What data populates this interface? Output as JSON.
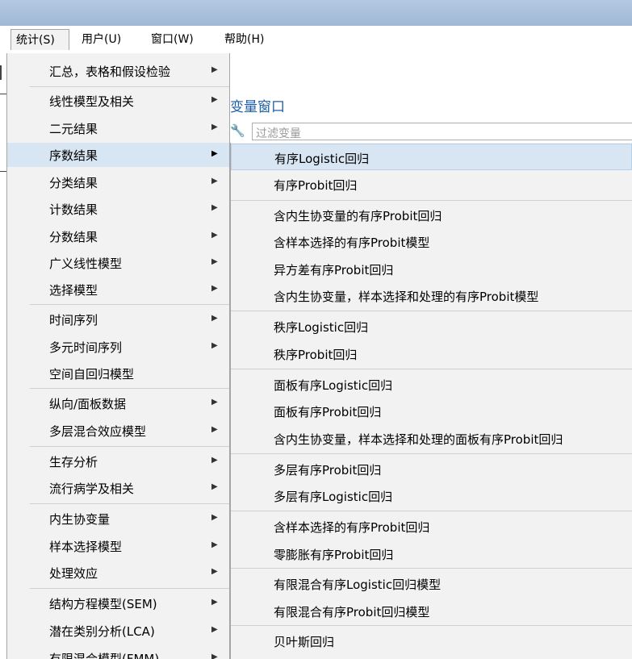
{
  "menubar": [
    "统计(S)",
    "用户(U)",
    "窗口(W)",
    "帮助(H)"
  ],
  "background": {
    "variables_title": "变量窗口",
    "filter_placeholder": "过滤变量"
  },
  "stats_menu": {
    "items": [
      {
        "label": "汇总，表格和假设检验",
        "submenu": true
      },
      {
        "label": "线性模型及相关",
        "submenu": true
      },
      {
        "label": "二元结果",
        "submenu": true
      },
      {
        "label": "序数结果",
        "submenu": true,
        "selected": true
      },
      {
        "label": "分类结果",
        "submenu": true
      },
      {
        "label": "计数结果",
        "submenu": true
      },
      {
        "label": "分数结果",
        "submenu": true
      },
      {
        "label": "广义线性模型",
        "submenu": true
      },
      {
        "label": "选择模型",
        "submenu": true
      },
      {
        "label": "时间序列",
        "submenu": true
      },
      {
        "label": "多元时间序列",
        "submenu": true
      },
      {
        "label": "空间自回归模型",
        "submenu": false
      },
      {
        "label": "纵向/面板数据",
        "submenu": true
      },
      {
        "label": "多层混合效应模型",
        "submenu": true
      },
      {
        "label": "生存分析",
        "submenu": true
      },
      {
        "label": "流行病学及相关",
        "submenu": true
      },
      {
        "label": "内生协变量",
        "submenu": true
      },
      {
        "label": "样本选择模型",
        "submenu": true
      },
      {
        "label": "处理效应",
        "submenu": true
      },
      {
        "label": "结构方程模型(SEM)",
        "submenu": true
      },
      {
        "label": "潜在类别分析(LCA)",
        "submenu": true
      },
      {
        "label": "有限混合模型(FMM)",
        "submenu": true
      }
    ]
  },
  "ordinal_submenu": {
    "items": [
      {
        "label": "有序Logistic回归",
        "selected": true
      },
      {
        "label": "有序Probit回归"
      },
      {
        "label": "含内生协变量的有序Probit回归"
      },
      {
        "label": "含样本选择的有序Probit模型"
      },
      {
        "label": "异方差有序Probit回归"
      },
      {
        "label": "含内生协变量，样本选择和处理的有序Probit模型"
      },
      {
        "label": "秩序Logistic回归"
      },
      {
        "label": "秩序Probit回归"
      },
      {
        "label": "面板有序Logistic回归"
      },
      {
        "label": "面板有序Probit回归"
      },
      {
        "label": "含内生协变量，样本选择和处理的面板有序Probit回归"
      },
      {
        "label": "多层有序Probit回归"
      },
      {
        "label": "多层有序Logistic回归"
      },
      {
        "label": "含样本选择的有序Probit回归"
      },
      {
        "label": "零膨胀有序Probit回归"
      },
      {
        "label": "有限混合有序Logistic回归模型"
      },
      {
        "label": "有限混合有序Probit回归模型"
      },
      {
        "label": "贝叶斯回归"
      }
    ]
  }
}
